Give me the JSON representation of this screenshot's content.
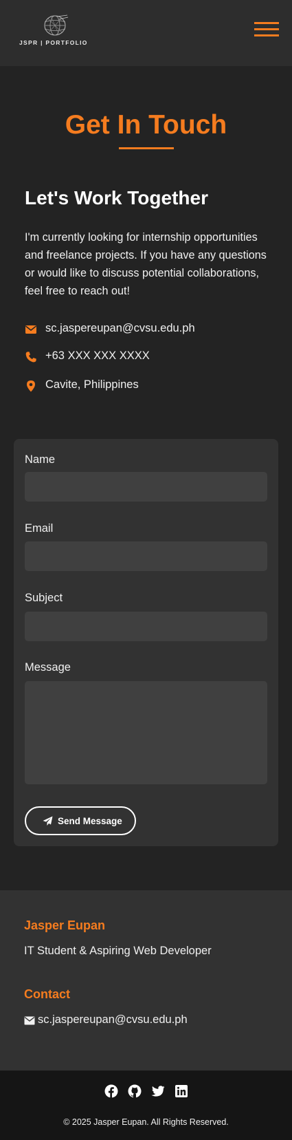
{
  "header": {
    "logo_text": "JSPR | PORTFOLIO",
    "logo_icon": "globe-sketch-icon",
    "menu_icon": "hamburger-menu-icon"
  },
  "section": {
    "title": "Get In Touch",
    "subheading": "Let's Work Together",
    "intro": "I'm currently looking for internship opportunities and freelance projects. If you have any questions or would like to discuss potential collaborations, feel free to reach out!"
  },
  "contact_info": {
    "email": "sc.jaspereupan@cvsu.edu.ph",
    "phone": "+63 XXX XXX XXXX",
    "location": "Cavite, Philippines"
  },
  "form": {
    "name_label": "Name",
    "email_label": "Email",
    "subject_label": "Subject",
    "message_label": "Message",
    "name_value": "",
    "email_value": "",
    "subject_value": "",
    "message_value": "",
    "submit_label": "Send Message",
    "submit_icon": "paper-plane-icon"
  },
  "footer": {
    "name": "Jasper Eupan",
    "tagline": "IT Student & Aspiring Web Developer",
    "contact_title": "Contact",
    "email": "sc.jaspereupan@cvsu.edu.ph"
  },
  "social": [
    "facebook-icon",
    "github-icon",
    "twitter-icon",
    "linkedin-icon"
  ],
  "copyright": "© 2025 Jasper Eupan. All Rights Reserved.",
  "colors": {
    "accent": "#f57c1f",
    "background": "#232323",
    "header_bg": "#2d2d2d",
    "card_bg": "#323232",
    "input_bg": "#404040",
    "footer_bottom_bg": "#151515"
  }
}
